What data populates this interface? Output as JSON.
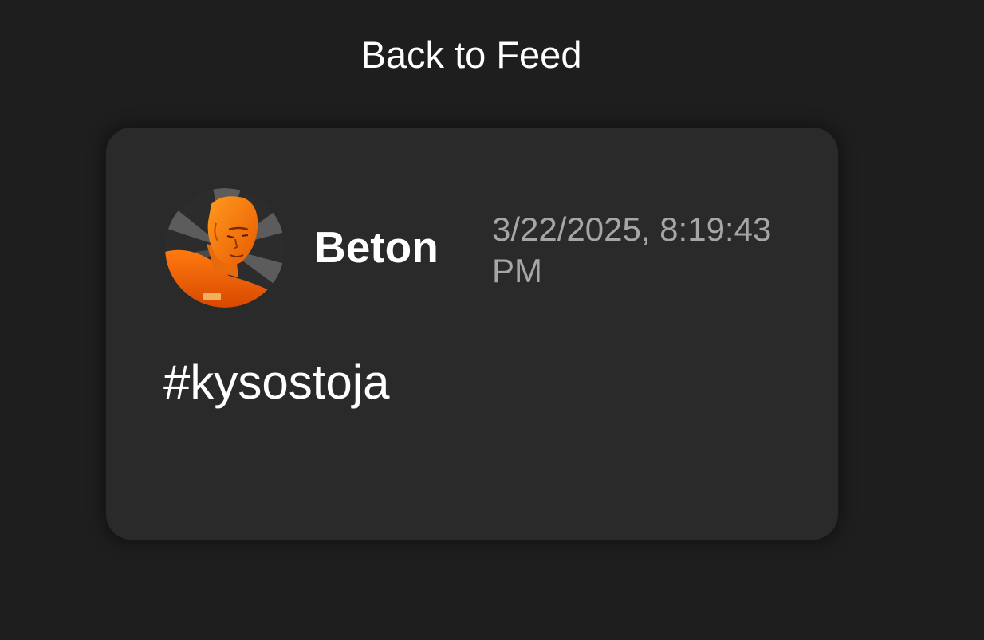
{
  "nav": {
    "back_label": "Back to Feed"
  },
  "post": {
    "author": "Beton",
    "timestamp": "3/22/2025, 8:19:43 PM",
    "content": "#kysostoja",
    "avatar_icon": "user-avatar-orange-figure"
  },
  "colors": {
    "background": "#1e1e1e",
    "card": "#2a2a2a",
    "text_primary": "#ffffff",
    "text_muted": "#a6a6a6",
    "avatar_accent": "#ff7a00"
  }
}
